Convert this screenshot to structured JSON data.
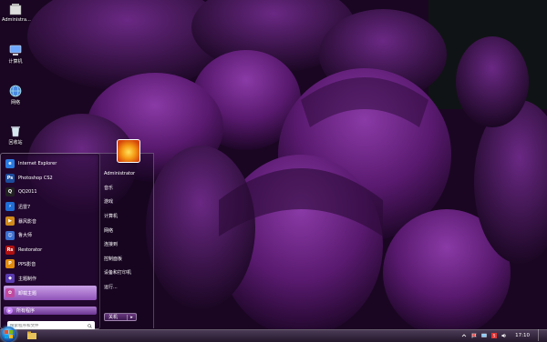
{
  "desktop": {
    "icons": [
      {
        "label": "Administra...",
        "icon": "user-folder-icon"
      },
      {
        "label": "计算机",
        "icon": "computer-icon"
      },
      {
        "label": "网络",
        "icon": "network-icon"
      },
      {
        "label": "回收站",
        "icon": "recycle-bin-icon"
      }
    ]
  },
  "start_menu": {
    "programs": [
      {
        "label": "Internet Explorer",
        "icon": "ie-icon",
        "glyph": "e",
        "color": "#2a7be0"
      },
      {
        "label": "Photoshop CS2",
        "icon": "photoshop-icon",
        "glyph": "Ps",
        "color": "#1c4c9c"
      },
      {
        "label": "QQ2011",
        "icon": "qq-icon",
        "glyph": "Q",
        "color": "#222"
      },
      {
        "label": "迅雷7",
        "icon": "thunder-icon",
        "glyph": "⚡",
        "color": "#1e6ed6"
      },
      {
        "label": "暴风影音",
        "icon": "storm-player-icon",
        "glyph": "▶",
        "color": "#d08a1a"
      },
      {
        "label": "鲁大师",
        "icon": "ludashi-icon",
        "glyph": "☺",
        "color": "#3b6fd0"
      },
      {
        "label": "Restorator",
        "icon": "restorator-icon",
        "glyph": "Rs",
        "color": "#b01010"
      },
      {
        "label": "PPS影音",
        "icon": "pps-icon",
        "glyph": "P",
        "color": "#e08a10"
      },
      {
        "label": "主题制作",
        "icon": "theme-maker-icon",
        "glyph": "◆",
        "color": "#5a3bb0"
      },
      {
        "label": "卸载主题",
        "icon": "uninstall-theme-icon",
        "glyph": "✿",
        "color": "#c04aa0",
        "highlight": true
      }
    ],
    "all_programs_label": "所有程序",
    "search_placeholder": "搜索程序和文件",
    "user_name": "Administrator",
    "right_links": [
      "音乐",
      "游戏",
      "计算机",
      "网络",
      "连接到",
      "控制面板",
      "设备和打印机",
      "运行..."
    ],
    "shutdown_label": "关机",
    "shutdown_arrow": "▸"
  },
  "taskbar": {
    "clock": "17:10",
    "tray_icons": [
      "chevron-up-icon",
      "flag-icon",
      "network-tray-icon",
      "input-method-icon",
      "volume-icon"
    ]
  },
  "colors": {
    "accent": "#8f52b8",
    "wallpaper_dark": "#12041a",
    "petal": "#5a1a70"
  }
}
